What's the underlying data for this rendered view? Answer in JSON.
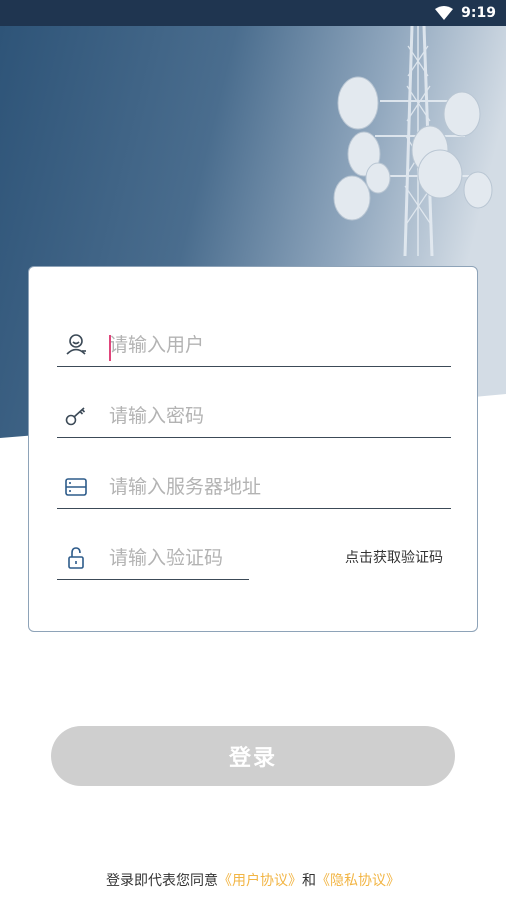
{
  "status_bar": {
    "time": "9:19"
  },
  "form": {
    "username_placeholder": "请输入用户",
    "password_placeholder": "请输入密码",
    "server_placeholder": "请输入服务器地址",
    "code_placeholder": "请输入验证码",
    "get_code_label": "点击获取验证码"
  },
  "login_button": {
    "label": "登录"
  },
  "agreement": {
    "prefix": "登录即代表您同意",
    "user_agreement": "《用户协议》",
    "conjunction": "和",
    "privacy_policy": "《隐私协议》",
    "link_color": "#f2b544"
  },
  "colors": {
    "header_dark": "#2f5579",
    "header_light": "#c9d4de",
    "button_disabled": "#cfcfcf"
  }
}
